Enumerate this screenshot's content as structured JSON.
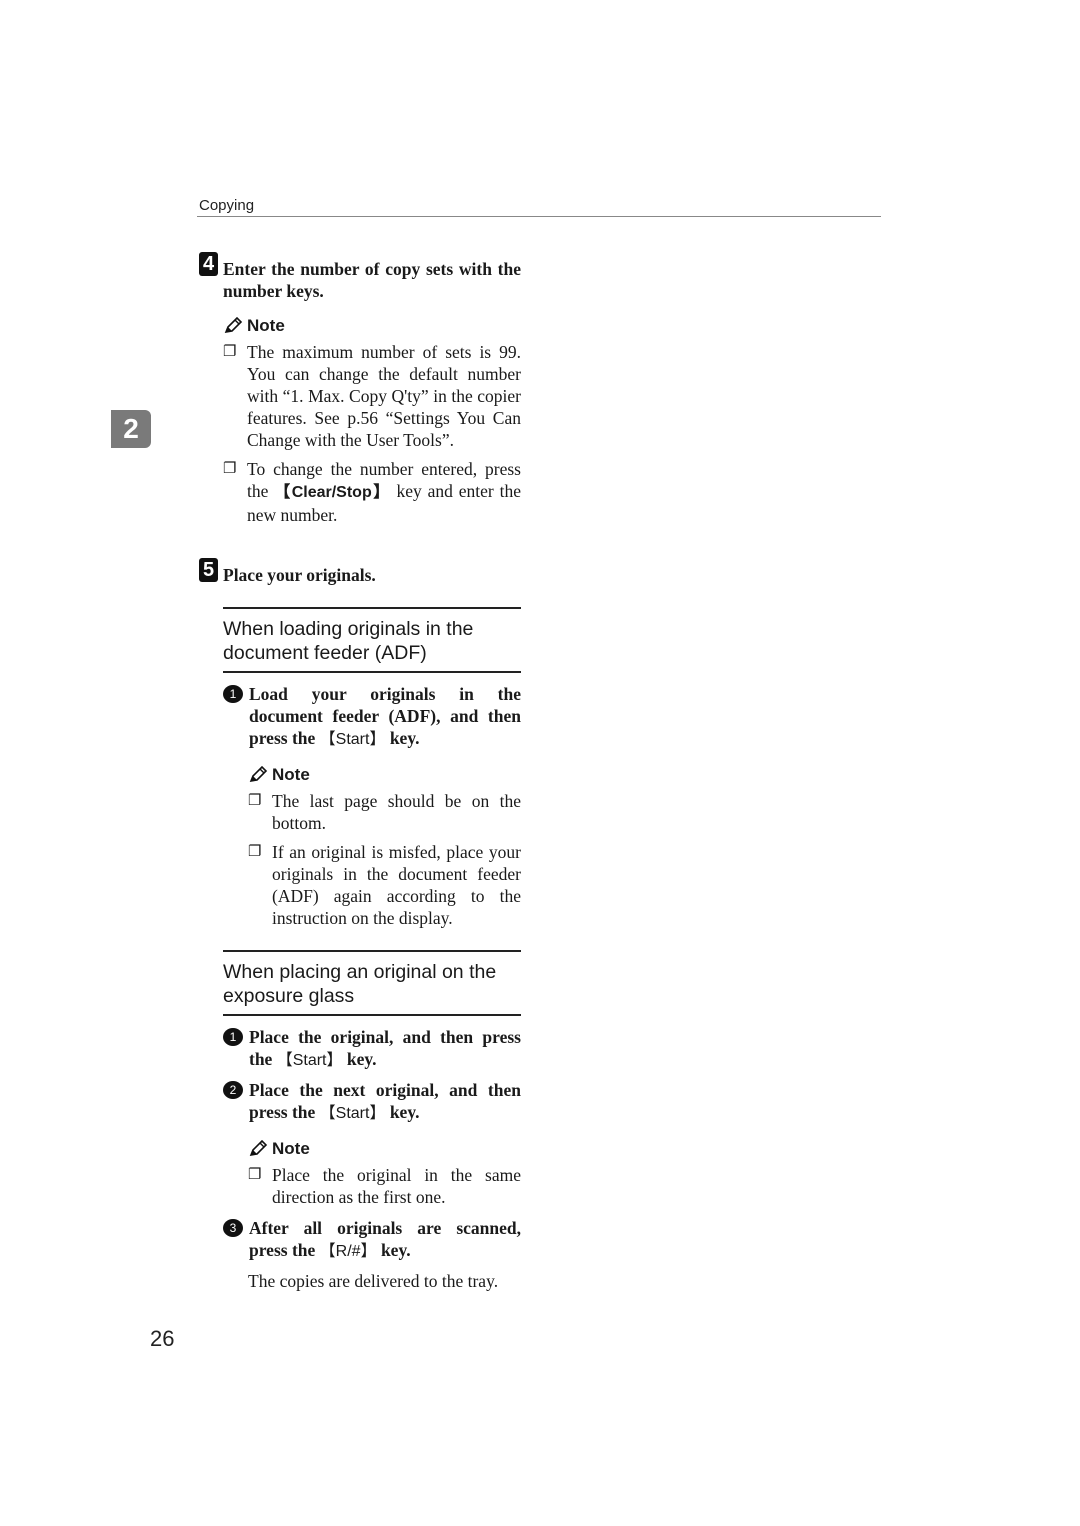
{
  "header": {
    "section": "Copying"
  },
  "chapter_tab": "2",
  "page_number": "26",
  "step4": {
    "number": "4",
    "title": "Enter the number of copy sets with the number keys.",
    "note_label": "Note",
    "notes": [
      "The maximum number of sets is 99. You can change the default number with “1. Max. Copy Q'ty” in the copier features. See p.56 “Settings You Can Change with the User Tools”.",
      {
        "before": "To change the number entered, press the ",
        "key": "【Clear/Stop】",
        "after": " key and enter the new number."
      }
    ]
  },
  "step5": {
    "number": "5",
    "title": "Place your originals.",
    "adf": {
      "heading": "When loading originals in the document feeder (ADF)",
      "substeps": [
        {
          "num": "1",
          "before": "Load your originals in the document feeder (ADF), and then press the ",
          "key": "【Start】",
          "after": " key."
        }
      ],
      "note_label": "Note",
      "notes": [
        "The last page should be on the bottom.",
        "If an original is misfed, place your originals in the document feeder (ADF) again according to the instruction on the display."
      ]
    },
    "glass": {
      "heading": "When placing an original on the exposure glass",
      "substeps": [
        {
          "num": "1",
          "before": "Place the original, and then press the ",
          "key": "【Start】",
          "after": " key."
        },
        {
          "num": "2",
          "before": "Place the next original, and then press the ",
          "key": "【Start】",
          "after": " key."
        },
        {
          "num": "3",
          "before": "After all originals are scanned, press the ",
          "key": "【R/#】",
          "after": " key."
        }
      ],
      "note_label": "Note",
      "notes": [
        "Place the original in the same direction as the first one."
      ],
      "result": "The copies are delivered to the tray."
    }
  },
  "icons": {
    "note": "pencil-icon",
    "bullet": "checkbox-bullet-icon"
  }
}
